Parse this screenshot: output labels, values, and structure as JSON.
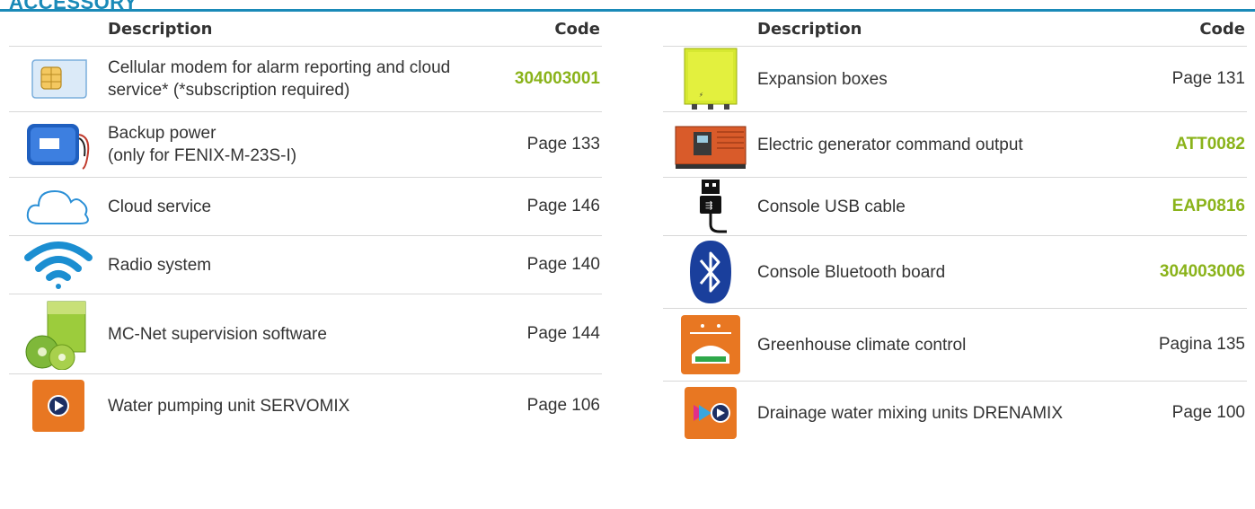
{
  "heading": "ACCESSORY",
  "colors": {
    "accent": "#1a8ab8",
    "code_green": "#8ab31a",
    "icon_orange": "#e87722"
  },
  "columns": {
    "description": "Description",
    "code": "Code"
  },
  "left_rows": [
    {
      "icon": "sim-card-icon",
      "description": "Cellular modem for alarm reporting and cloud service* (*subscription required)",
      "code": "304003001",
      "code_style": "link"
    },
    {
      "icon": "battery-pack-icon",
      "description": "Backup power\n(only for FENIX-M-23S-I)",
      "code": "Page 133",
      "code_style": "plain"
    },
    {
      "icon": "cloud-icon",
      "description": "Cloud service",
      "code": "Page 146",
      "code_style": "plain"
    },
    {
      "icon": "wifi-icon",
      "description": "Radio system",
      "code": "Page 140",
      "code_style": "plain"
    },
    {
      "icon": "software-box-icon",
      "description": "MC-Net supervision software",
      "code": "Page 144",
      "code_style": "plain"
    },
    {
      "icon": "pump-unit-icon",
      "description": "Water pumping unit SERVOMIX",
      "code": "Page 106",
      "code_style": "plain"
    }
  ],
  "right_rows": [
    {
      "icon": "expansion-box-icon",
      "description": "Expansion boxes",
      "code": "Page 131",
      "code_style": "plain"
    },
    {
      "icon": "generator-icon",
      "description": "Electric generator command output",
      "code": "ATT0082",
      "code_style": "link"
    },
    {
      "icon": "usb-cable-icon",
      "description": "Console USB cable",
      "code": "EAP0816",
      "code_style": "link"
    },
    {
      "icon": "bluetooth-icon",
      "description": "Console Bluetooth board",
      "code": "304003006",
      "code_style": "link"
    },
    {
      "icon": "greenhouse-icon",
      "description": "Greenhouse climate control",
      "code": "Pagina 135",
      "code_style": "plain"
    },
    {
      "icon": "mixing-unit-icon",
      "description": "Drainage water mixing units DRENAMIX",
      "code": "Page 100",
      "code_style": "plain"
    }
  ]
}
